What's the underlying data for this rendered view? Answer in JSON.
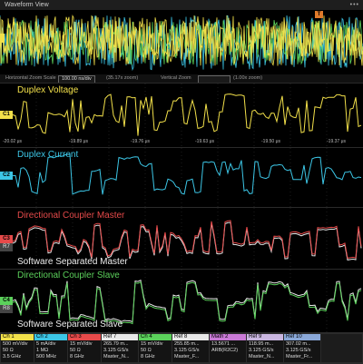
{
  "window": {
    "title": "Waveform View",
    "menu_dots": "•••"
  },
  "overview": {
    "trigger_marker": "T"
  },
  "zoom_bar": {
    "horizontal_label": "Horizontal Zoom Scale",
    "horizontal_value": "100.00 ns/div",
    "horizontal_zoom": "(35.17x zoom)",
    "vertical_label": "Vertical Zoom",
    "vertical_value": "(1.00x zoom)"
  },
  "time_ticks": [
    "-20.02 μs",
    "-19.89 μs",
    "-19.76 μs",
    "-19.63 μs",
    "-19.50 μs",
    "-19.37 μs"
  ],
  "panels": [
    {
      "title": "Duplex Voltage",
      "title_color": "#f2e04a",
      "badge": "C1",
      "badge_color": "#f2e04a"
    },
    {
      "title": "Duplex Current",
      "title_color": "#3cc6e6",
      "badge": "C2",
      "badge_color": "#3cc6e6"
    },
    {
      "title": "Directional Coupler Master",
      "title_color": "#e64a4a",
      "subtitle": "Software Separated Master",
      "badge": "C3",
      "badge_color": "#e64a4a",
      "ref_badge": "R7"
    },
    {
      "title": "Directional Coupler Slave",
      "title_color": "#5bd15b",
      "subtitle": "Software Separated Slave",
      "badge": "C4",
      "badge_color": "#5bd15b",
      "ref_badge": "R8"
    }
  ],
  "channels": [
    {
      "name": "Ch 1",
      "color": "#f2e04a",
      "lines": [
        "500 mV/div",
        "50 Ω",
        "3.5 GHz"
      ]
    },
    {
      "name": "Ch 2",
      "color": "#3cc6e6",
      "lines": [
        "5 mA/div",
        "1 MΩ",
        "500 MHz"
      ]
    },
    {
      "name": "Ch 3",
      "color": "#e64a4a",
      "lines": [
        "15 mV/div",
        "50 Ω",
        "8 GHz"
      ]
    },
    {
      "name": "Ref 7",
      "color": "#e8e8e8",
      "lines": [
        "265.79 m...",
        "3.125 GS/s",
        "Master_N..."
      ]
    },
    {
      "name": "Ch 4",
      "color": "#5bd15b",
      "lines": [
        "15 mV/div",
        "50 Ω",
        "8 GHz"
      ]
    },
    {
      "name": "Ref 8",
      "color": "#e8e8e8",
      "lines": [
        "255.85 m...",
        "3.125 GS/s",
        "Master_F..."
      ]
    },
    {
      "name": "Math 2",
      "color": "#c97ad6",
      "lines": [
        "13.5671 ...",
        "ARB(R2C2)"
      ]
    },
    {
      "name": "Ref 9",
      "color": "#c9b6e0",
      "lines": [
        "118.95 m...",
        "3.125 GS/s",
        "Master_N..."
      ]
    },
    {
      "name": "Ref 10",
      "color": "#8aa8d8",
      "lines": [
        "307.02 m...",
        "3.125 GS/s",
        "Master_Fr..."
      ]
    }
  ]
}
